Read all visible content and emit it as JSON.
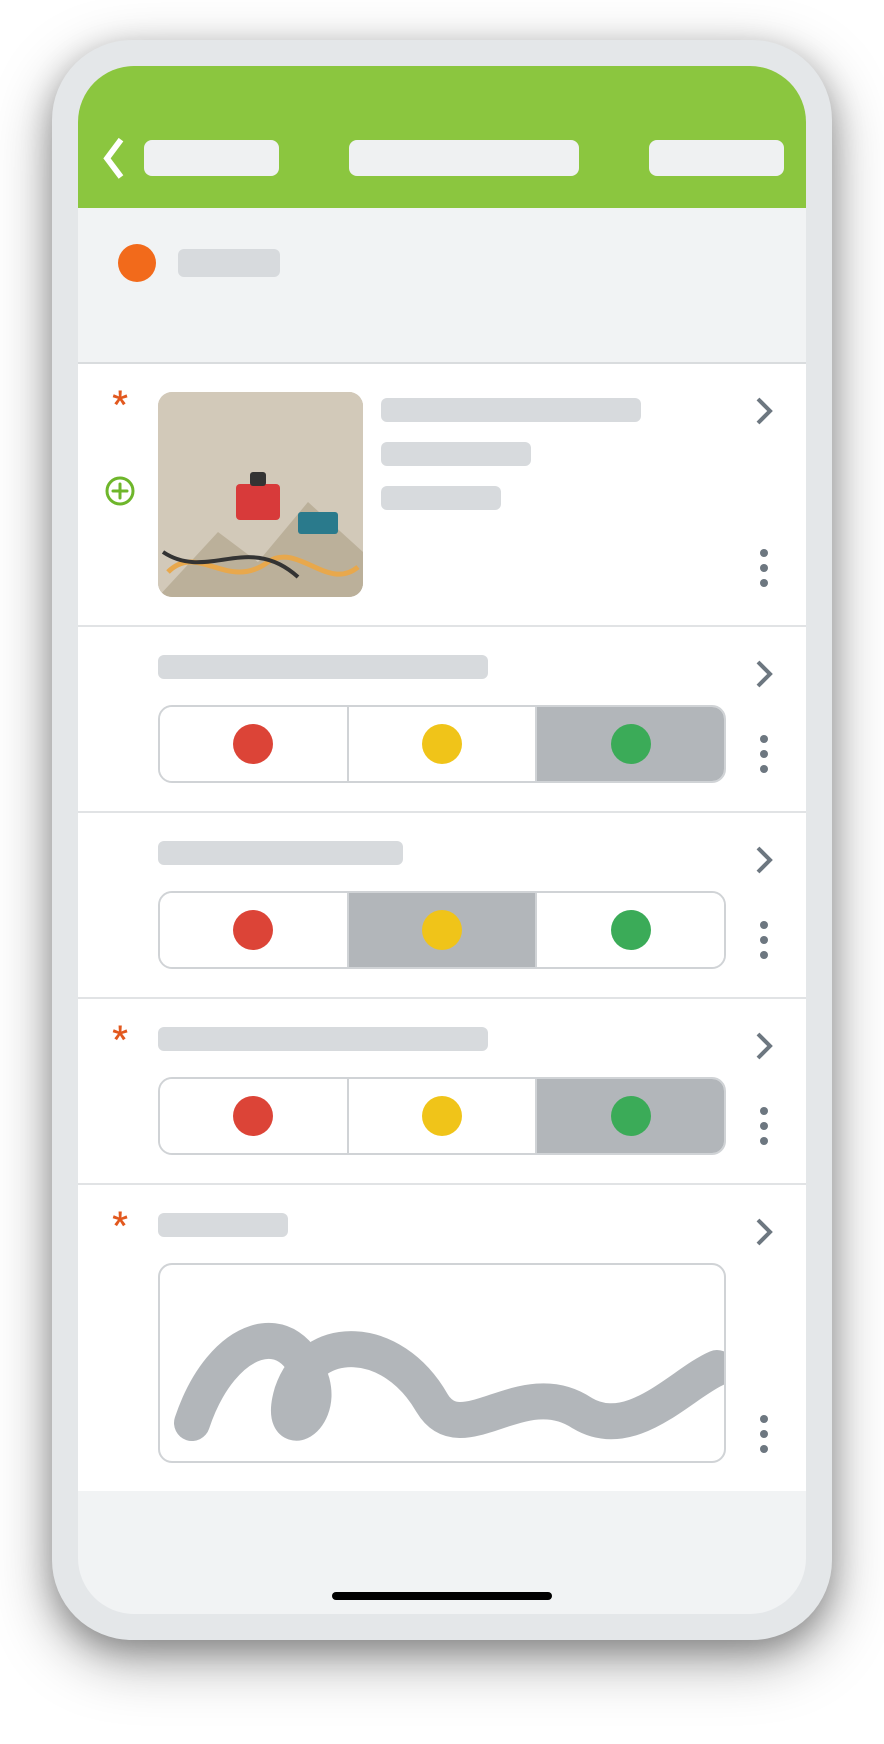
{
  "header": {
    "back_icon": "chevron-left",
    "left_label": "",
    "title": "",
    "right_label": ""
  },
  "status": {
    "dot_color": "#f26a1b",
    "label": ""
  },
  "items": [
    {
      "type": "photo",
      "required": true,
      "has_add": true,
      "image_alt": "Worksite cables and equipment on concrete floor",
      "title": "",
      "subtitle": "",
      "detail": ""
    },
    {
      "type": "traffic",
      "required": false,
      "question": "",
      "options": [
        "red",
        "yellow",
        "green"
      ],
      "selected": "green"
    },
    {
      "type": "traffic",
      "required": false,
      "question": "",
      "options": [
        "red",
        "yellow",
        "green"
      ],
      "selected": "yellow"
    },
    {
      "type": "traffic",
      "required": true,
      "question": "",
      "options": [
        "red",
        "yellow",
        "green"
      ],
      "selected": "green"
    },
    {
      "type": "signature",
      "required": true,
      "label": "",
      "has_signature": true
    }
  ],
  "colors": {
    "brand": "#8bc63f",
    "accent": "#f26a1b",
    "red": "#dc4437",
    "yellow": "#f0c419",
    "green": "#3bab58"
  }
}
